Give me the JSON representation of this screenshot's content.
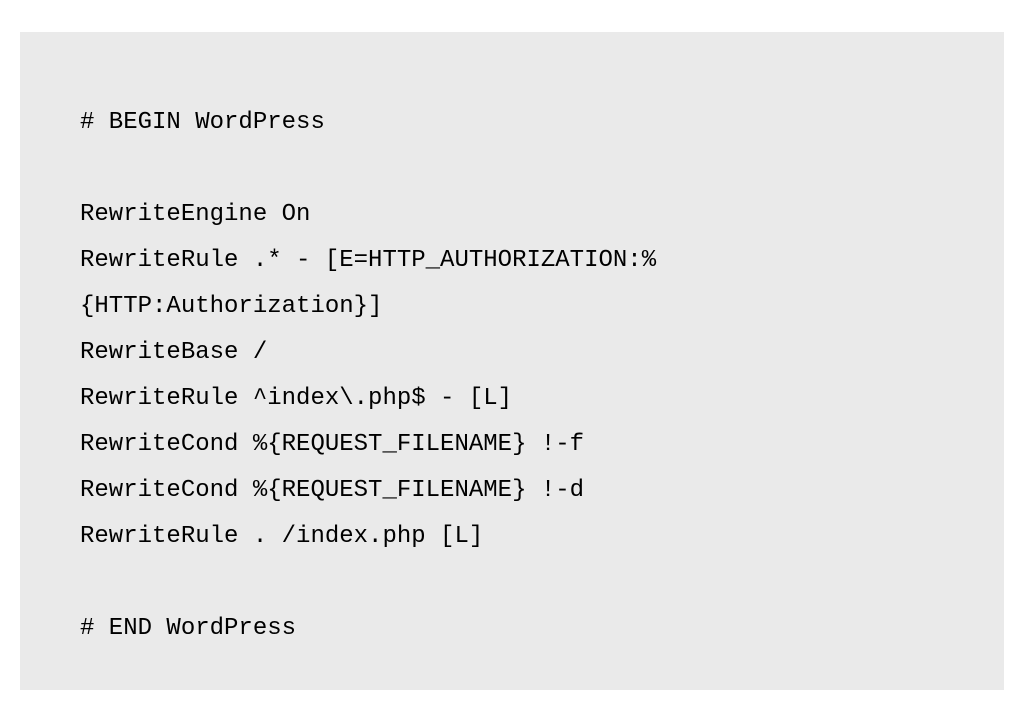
{
  "code": {
    "lines": [
      "# BEGIN WordPress",
      "",
      "RewriteEngine On",
      "RewriteRule .* - [E=HTTP_AUTHORIZATION:%{HTTP:Authorization}]",
      "RewriteBase /",
      "RewriteRule ^index\\.php$ - [L]",
      "RewriteCond %{REQUEST_FILENAME} !-f",
      "RewriteCond %{REQUEST_FILENAME} !-d",
      "RewriteRule . /index.php [L]",
      "",
      "# END WordPress"
    ]
  }
}
